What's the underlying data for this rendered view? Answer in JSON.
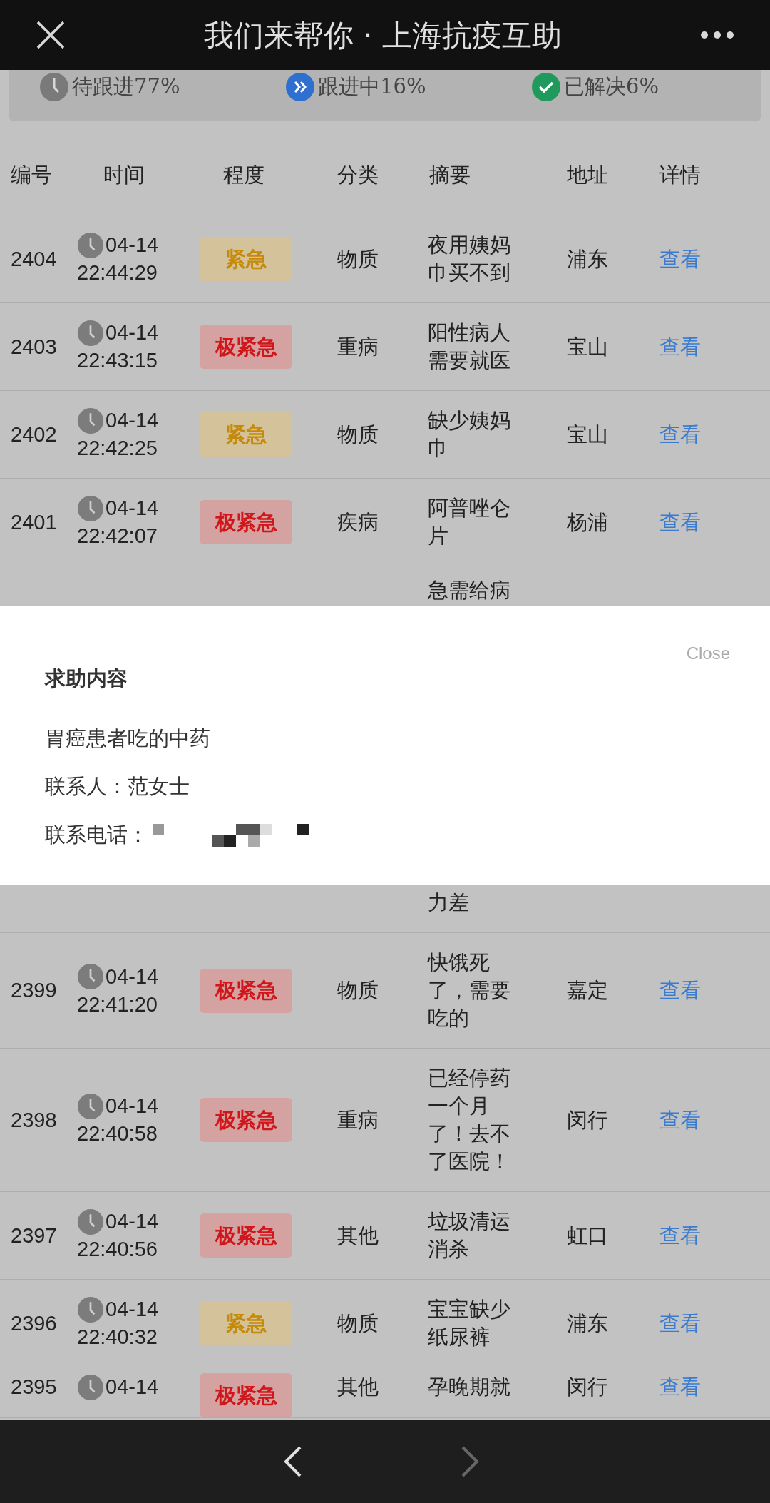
{
  "header": {
    "title": "我们来帮你 · 上海抗疫互助"
  },
  "stats": [
    {
      "kind": "pending",
      "label": "待跟进77%",
      "color": "#7a7a7a"
    },
    {
      "kind": "in_progress",
      "label": "跟进中16%",
      "color": "#2f6fd0"
    },
    {
      "kind": "resolved",
      "label": "已解决6%",
      "color": "#1f9a5c"
    }
  ],
  "table": {
    "columns": [
      "编号",
      "时间",
      "程度",
      "分类",
      "摘要",
      "地址",
      "详情"
    ],
    "rows": [
      {
        "kind": "full",
        "id": "2404",
        "date": "04-14",
        "time": "22:44:29",
        "level": "紧急",
        "critical": false,
        "category": "物质",
        "summary": [
          "夜用姨妈",
          "巾买不到"
        ],
        "address": "浦东",
        "link": "查看"
      },
      {
        "kind": "full",
        "id": "2403",
        "date": "04-14",
        "time": "22:43:15",
        "level": "极紧急",
        "critical": true,
        "category": "重病",
        "summary": [
          "阳性病人",
          "需要就医"
        ],
        "address": "宝山",
        "link": "查看"
      },
      {
        "kind": "full",
        "id": "2402",
        "date": "04-14",
        "time": "22:42:25",
        "level": "紧急",
        "critical": false,
        "category": "物质",
        "summary": [
          "缺少姨妈",
          "巾"
        ],
        "address": "宝山",
        "link": "查看"
      },
      {
        "kind": "full",
        "id": "2401",
        "date": "04-14",
        "time": "22:42:07",
        "level": "极紧急",
        "critical": true,
        "category": "疾病",
        "summary": [
          "阿普唑仑",
          "片"
        ],
        "address": "杨浦",
        "link": "查看"
      },
      {
        "kind": "covered",
        "summary_top": "急需给病",
        "summary_bottom": "力差"
      },
      {
        "kind": "full",
        "id": "2399",
        "date": "04-14",
        "time": "22:41:20",
        "level": "极紧急",
        "critical": true,
        "category": "物质",
        "summary": [
          "快饿死",
          "了，需要",
          "吃的"
        ],
        "address": "嘉定",
        "link": "查看"
      },
      {
        "kind": "full",
        "id": "2398",
        "date": "04-14",
        "time": "22:40:58",
        "level": "极紧急",
        "critical": true,
        "category": "重病",
        "summary": [
          "已经停药",
          "一个月",
          "了！去不",
          "了医院！"
        ],
        "address": "闵行",
        "link": "查看"
      },
      {
        "kind": "full",
        "id": "2397",
        "date": "04-14",
        "time": "22:40:56",
        "level": "极紧急",
        "critical": true,
        "category": "其他",
        "summary": [
          "垃圾清运",
          "消杀"
        ],
        "address": "虹口",
        "link": "查看"
      },
      {
        "kind": "full",
        "id": "2396",
        "date": "04-14",
        "time": "22:40:32",
        "level": "紧急",
        "critical": false,
        "category": "物质",
        "summary": [
          "宝宝缺少",
          "纸尿裤"
        ],
        "address": "浦东",
        "link": "查看"
      },
      {
        "kind": "cut",
        "id": "2395",
        "date": "04-14",
        "level": "极紧急",
        "critical": true,
        "category": "其他",
        "summary": [
          "孕晚期就"
        ],
        "address": "闵行",
        "link": "查看"
      }
    ]
  },
  "modal": {
    "close": "Close",
    "title": "求助内容",
    "content": "胃癌患者吃的中药",
    "contact": "联系人：范女士",
    "phone_label": "联系电话："
  },
  "nav": {
    "back": {
      "disabled": false
    },
    "forward": {
      "disabled": true
    }
  }
}
